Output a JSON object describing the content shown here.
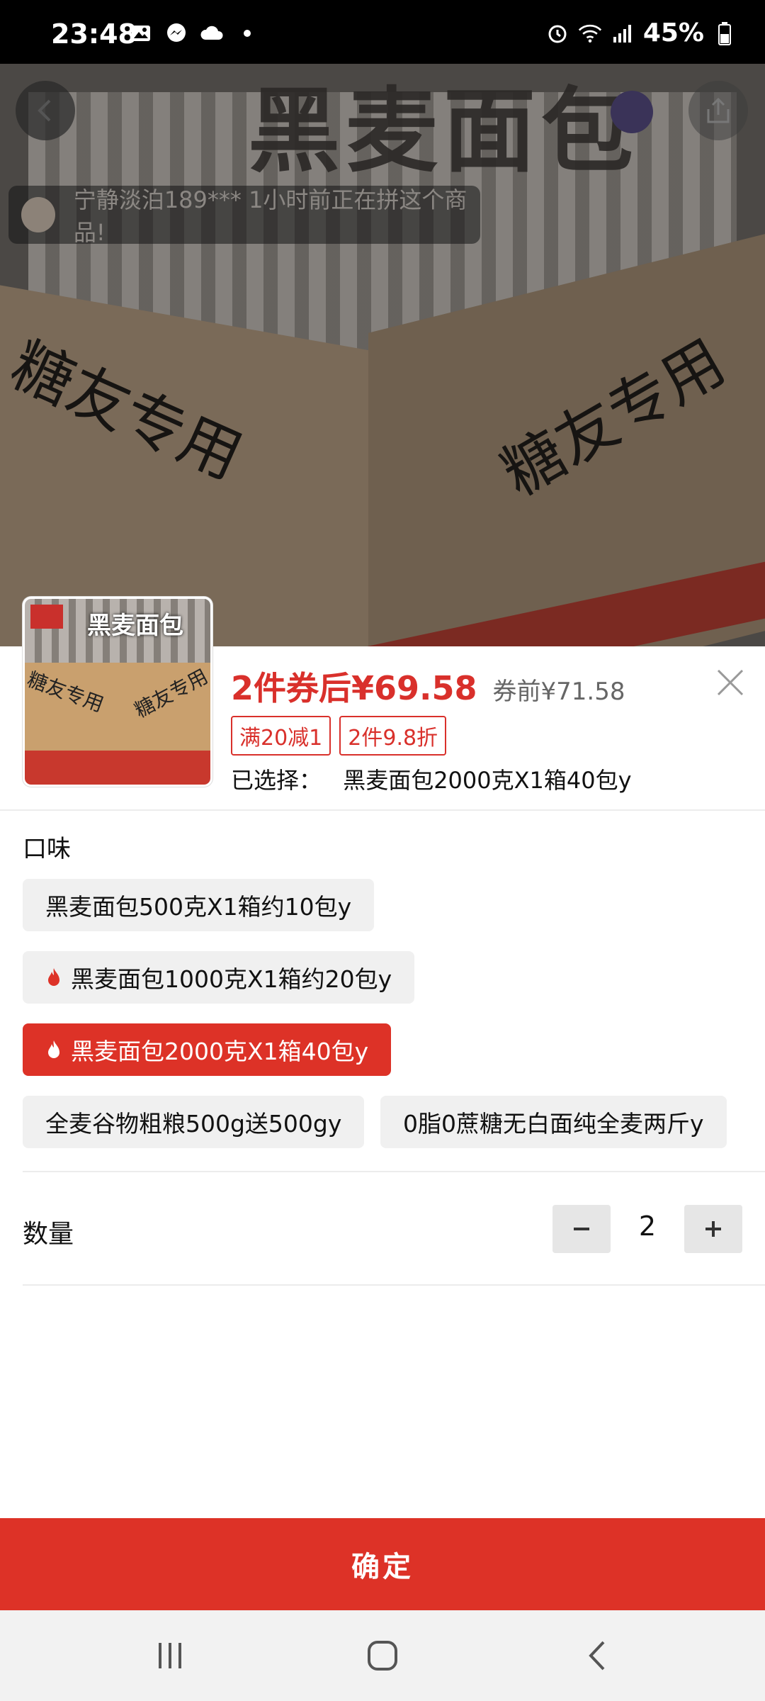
{
  "status_bar": {
    "time": "23:48",
    "battery": "45%",
    "icons_left": [
      "image-icon",
      "messenger-icon",
      "cloud-icon",
      "dot-icon"
    ],
    "icons_right": [
      "alarm-icon",
      "wifi-icon",
      "signal-icon",
      "battery-icon"
    ]
  },
  "product_header": {
    "banner_title": "黑麦面包",
    "stamp_text": "糖友专用",
    "live_notice": "宁静淡泊189*** 1小时前正在拼这个商品!"
  },
  "sheet": {
    "thumbnail_title": "黑麦面包",
    "thumbnail_stamp": "糖友专用",
    "price": "2件券后¥69.58",
    "original_price": "券前¥71.58",
    "tags": [
      "满20减1",
      "2件9.8折"
    ],
    "selected_label": "已选择：",
    "selected_value": "黑麦面包2000克X1箱40包y",
    "flavor_title": "口味",
    "options": [
      {
        "label": "黑麦面包500克X1箱约10包y",
        "hot": false,
        "selected": false
      },
      {
        "label": "黑麦面包1000克X1箱约20包y",
        "hot": true,
        "selected": false
      },
      {
        "label": "黑麦面包2000克X1箱40包y",
        "hot": true,
        "selected": true
      },
      {
        "label": "全麦谷物粗粮500g送500gy",
        "hot": false,
        "selected": false
      },
      {
        "label": "0脂0蔗糖无白面纯全麦两斤y",
        "hot": false,
        "selected": false
      }
    ],
    "quantity_label": "数量",
    "quantity_value": "2",
    "confirm_label": "确定"
  },
  "colors": {
    "accent": "#dd3227",
    "price_red": "#d9302b",
    "option_bg": "#f0f0f0"
  }
}
